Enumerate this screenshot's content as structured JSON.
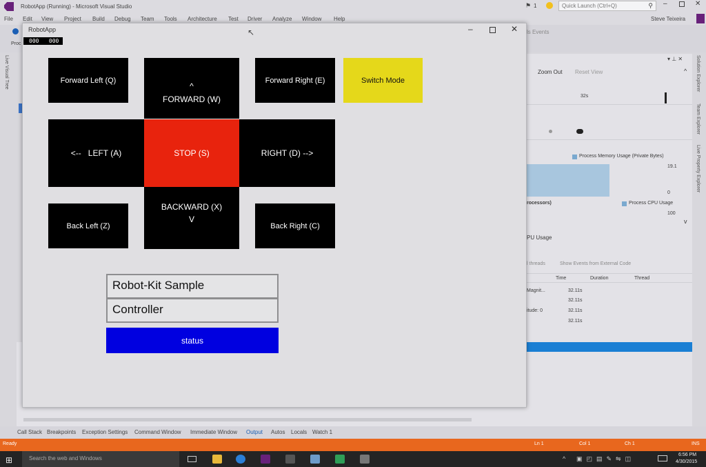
{
  "vs": {
    "title": "RobotApp (Running) - Microsoft Visual Studio",
    "quick_launch": "Quick Launch (Ctrl+Q)",
    "user": "Steve Teixeira",
    "notif_count": "1",
    "menu": [
      "File",
      "Edit",
      "View",
      "Project",
      "Build",
      "Debug",
      "Team",
      "Tools",
      "Architecture",
      "Test",
      "Driver",
      "Analyze",
      "Window",
      "Help"
    ],
    "toolbar_frag": "Proc",
    "events_frag": "ls Events",
    "side_left": "Live Visual Tree",
    "side_right": [
      "Solution Explorer",
      "Team Explorer",
      "Live Property Explorer"
    ]
  },
  "diagnostics": {
    "zoom_out": "Zoom Out",
    "reset_view": "Reset View",
    "time_32s": "32s",
    "memory_label": "Process Memory Usage (Private Bytes)",
    "memory_max": "19.1",
    "memory_min": "0",
    "processors": "rocessors)",
    "cpu_label": "Process CPU Usage",
    "cpu_max": "100",
    "cpu_usage": "PU Usage",
    "threads_frag": "l threads",
    "show_external": "Show Events from External Code",
    "columns": [
      "Time",
      "Duration",
      "Thread"
    ],
    "rows": [
      {
        "name": "Magnit...",
        "time": "32.11s"
      },
      {
        "name": "",
        "time": "32.11s"
      },
      {
        "name": "itude: 0",
        "time": "32.11s"
      },
      {
        "name": "",
        "time": "32.11s"
      }
    ]
  },
  "bottom_tabs": [
    "Call Stack",
    "Breakpoints",
    "Exception Settings",
    "Command Window",
    "Immediate Window",
    "Output",
    "Autos",
    "Locals",
    "Watch 1"
  ],
  "status_bar": {
    "ready": "Ready",
    "ln": "Ln 1",
    "col": "Col 1",
    "ch": "Ch 1",
    "ins": "INS"
  },
  "taskbar": {
    "search": "Search the web and Windows",
    "time": "6:56 PM",
    "date": "4/30/2015"
  },
  "app": {
    "title": "RobotApp",
    "counter": "000   000",
    "buttons": {
      "forward_left": "Forward Left (Q)",
      "forward_arrow": "^",
      "forward": "FORWARD (W)",
      "forward_right": "Forward Right (E)",
      "switch_mode": "Switch Mode",
      "left": "<--   LEFT (A)",
      "stop": "STOP (S)",
      "right": "RIGHT (D) -->",
      "back_left": "Back Left (Z)",
      "backward": "BACKWARD (X)",
      "backward_arrow": "V",
      "back_right": "Back Right (C)"
    },
    "textbox1": "Robot-Kit Sample",
    "textbox2": "Controller",
    "status": "status"
  },
  "colors": {
    "stop": "#e8230d",
    "switch_mode": "#e5d81a",
    "status": "#0000e0",
    "vs_status_bar": "#e8671e"
  }
}
